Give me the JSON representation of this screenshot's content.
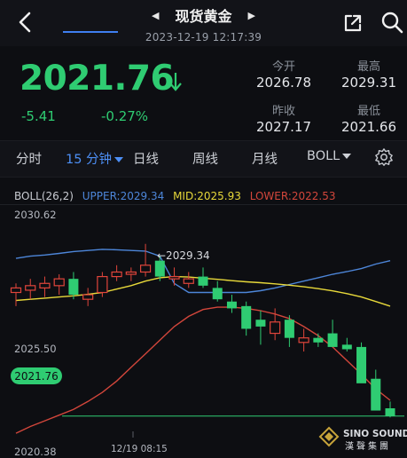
{
  "header": {
    "title": "现货黄金",
    "datetime": "2023-12-19 12:17:39"
  },
  "quote": {
    "price": "2021.76",
    "change": "-5.41",
    "change_pct": "-0.27%",
    "open_label": "今开",
    "open": "2026.78",
    "high_label": "最高",
    "high": "2029.31",
    "prev_close_label": "昨收",
    "prev_close": "2027.17",
    "low_label": "最低",
    "low": "2021.66"
  },
  "tabs": {
    "items": [
      "分时",
      "15 分钟",
      "日线",
      "周线",
      "月线",
      "BOLL"
    ],
    "active": "15 分钟"
  },
  "indicator": {
    "name": "BOLL(26,2)",
    "upper": "UPPER:2029.34",
    "mid": "MID:2025.93",
    "lower": "LOWER:2022.53"
  },
  "colors": {
    "up": "#e0453b",
    "down": "#2fcc72",
    "upper": "#4d86d9",
    "mid": "#e8d93a",
    "lower": "#d2463b",
    "accent": "#4d8ff5"
  },
  "chart_data": {
    "type": "candlestick",
    "y_top_label": "2030.62",
    "y_mid_label": "2025.50",
    "y_bottom_label": "2020.38",
    "ylim": [
      2020.38,
      2030.62
    ],
    "x_label": "12/19 08:15",
    "max_annotation": "←2029.34",
    "current_price": "2021.76",
    "watermark_line1": "SINO SOUND",
    "watermark_line2": "漢聲集團",
    "candles": [
      {
        "o": 2027.2,
        "h": 2027.6,
        "l": 2026.6,
        "c": 2027.4
      },
      {
        "o": 2027.3,
        "h": 2027.8,
        "l": 2026.9,
        "c": 2027.5
      },
      {
        "o": 2027.4,
        "h": 2027.9,
        "l": 2027.0,
        "c": 2027.6
      },
      {
        "o": 2027.5,
        "h": 2028.0,
        "l": 2027.1,
        "c": 2027.8
      },
      {
        "o": 2027.8,
        "h": 2028.1,
        "l": 2026.9,
        "c": 2027.1
      },
      {
        "o": 2026.9,
        "h": 2027.4,
        "l": 2026.6,
        "c": 2027.1
      },
      {
        "o": 2027.2,
        "h": 2028.1,
        "l": 2027.0,
        "c": 2027.9
      },
      {
        "o": 2027.9,
        "h": 2028.4,
        "l": 2027.7,
        "c": 2028.1
      },
      {
        "o": 2028.0,
        "h": 2028.3,
        "l": 2027.7,
        "c": 2028.1
      },
      {
        "o": 2028.1,
        "h": 2029.34,
        "l": 2027.9,
        "c": 2028.4
      },
      {
        "o": 2028.6,
        "h": 2028.8,
        "l": 2027.7,
        "c": 2027.9
      },
      {
        "o": 2027.8,
        "h": 2028.3,
        "l": 2027.5,
        "c": 2027.9
      },
      {
        "o": 2027.6,
        "h": 2028.1,
        "l": 2027.4,
        "c": 2027.8
      },
      {
        "o": 2027.9,
        "h": 2028.3,
        "l": 2027.4,
        "c": 2027.5
      },
      {
        "o": 2027.4,
        "h": 2027.7,
        "l": 2026.8,
        "c": 2026.9
      },
      {
        "o": 2026.8,
        "h": 2027.1,
        "l": 2026.3,
        "c": 2026.5
      },
      {
        "o": 2026.6,
        "h": 2026.8,
        "l": 2025.3,
        "c": 2025.6
      },
      {
        "o": 2026.0,
        "h": 2026.4,
        "l": 2024.9,
        "c": 2025.7
      },
      {
        "o": 2025.4,
        "h": 2026.5,
        "l": 2025.1,
        "c": 2025.9
      },
      {
        "o": 2026.0,
        "h": 2026.2,
        "l": 2024.8,
        "c": 2025.2
      },
      {
        "o": 2025.0,
        "h": 2025.6,
        "l": 2024.6,
        "c": 2025.2
      },
      {
        "o": 2025.2,
        "h": 2025.4,
        "l": 2024.8,
        "c": 2025.0
      },
      {
        "o": 2025.4,
        "h": 2026.0,
        "l": 2024.9,
        "c": 2024.8
      },
      {
        "o": 2024.9,
        "h": 2025.2,
        "l": 2024.6,
        "c": 2024.7
      },
      {
        "o": 2024.8,
        "h": 2025.0,
        "l": 2023.7,
        "c": 2023.2
      },
      {
        "o": 2023.4,
        "h": 2023.8,
        "l": 2022.2,
        "c": 2022.0
      },
      {
        "o": 2022.1,
        "h": 2022.4,
        "l": 2021.7,
        "c": 2021.76
      }
    ],
    "upper_band": [
      2028.7,
      2028.8,
      2028.85,
      2028.92,
      2029.0,
      2029.05,
      2029.1,
      2029.08,
      2029.05,
      2029.02,
      2028.8,
      2027.6,
      2027.2,
      2027.2,
      2027.2,
      2027.2,
      2027.2,
      2027.28,
      2027.4,
      2027.55,
      2027.7,
      2027.85,
      2028.0,
      2028.12,
      2028.25,
      2028.45,
      2028.6
    ],
    "mid_band": [
      2026.85,
      2026.9,
      2026.95,
      2027.0,
      2027.05,
      2027.12,
      2027.2,
      2027.35,
      2027.5,
      2027.7,
      2027.85,
      2027.9,
      2027.88,
      2027.83,
      2027.78,
      2027.72,
      2027.67,
      2027.63,
      2027.58,
      2027.52,
      2027.45,
      2027.37,
      2027.27,
      2027.15,
      2027.0,
      2026.8,
      2026.6
    ],
    "lower_band": [
      2021.0,
      2021.3,
      2021.55,
      2021.8,
      2022.05,
      2022.4,
      2022.8,
      2023.3,
      2023.9,
      2024.5,
      2025.1,
      2025.7,
      2026.15,
      2026.45,
      2026.55,
      2026.55,
      2026.5,
      2026.4,
      2026.25,
      2026.05,
      2025.7,
      2025.3,
      2024.8,
      2024.2,
      2023.6,
      2022.95,
      2022.45
    ]
  }
}
